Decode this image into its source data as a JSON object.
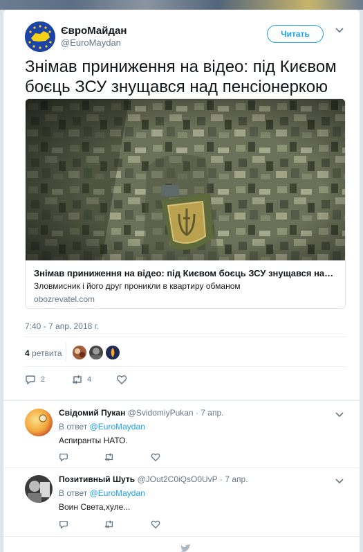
{
  "tweet": {
    "author_name": "ЄвроМайдан",
    "author_handle": "@EuroMaydan",
    "follow_label": "Читать",
    "text": "Знімав приниження на відео: під Києвом боєць ЗСУ знущався над пенсіонеркою",
    "card": {
      "title": "Знімав приниження на відео: під Києвом боєць ЗСУ знущався над пенсіо…",
      "description": "Зловмисник і його друг проникли в квартиру обманом",
      "domain": "obozrevatel.com"
    },
    "timestamp": "7:40 - 7 апр. 2018 г.",
    "retweets_count": "4",
    "retweets_label": "ретвита",
    "actions": {
      "replies": "2",
      "retweets": "4",
      "likes": ""
    }
  },
  "replies": [
    {
      "name": "Свідомий Пукан",
      "handle": "@SvidomiyPukan",
      "time": "· 7 апр.",
      "in_reply_prefix": "В ответ",
      "in_reply_to": "@EuroMaydan",
      "text": "Аспиранты НАТО."
    },
    {
      "name": "Позитивный Шуть",
      "handle": "@JOut2C0iQsO0UvP",
      "time": "· 7 апр.",
      "in_reply_prefix": "В ответ",
      "in_reply_to": "@EuroMaydan",
      "text": "Воин Света,хуле..."
    }
  ],
  "colors": {
    "accent": "#1da1f2",
    "secondary_text": "#657786",
    "divider": "#e6ecf0"
  }
}
